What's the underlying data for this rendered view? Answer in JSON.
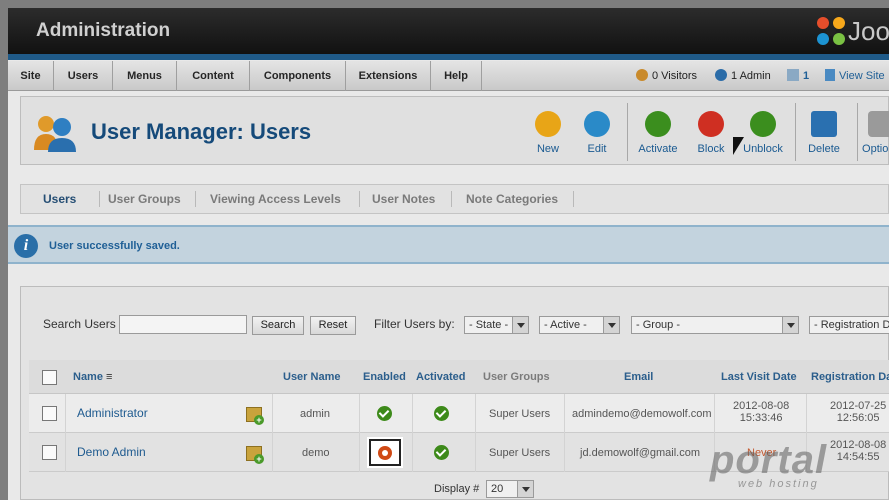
{
  "header": {
    "title": "Administration",
    "logo_text": "Joomla!"
  },
  "menu": {
    "items": [
      "Site",
      "Users",
      "Menus",
      "Content",
      "Components",
      "Extensions",
      "Help"
    ]
  },
  "status": {
    "visitors": "0 Visitors",
    "admins": "1 Admin",
    "messages": "1",
    "view_site": "View Site"
  },
  "toolbar": {
    "title": "User Manager: Users",
    "buttons": [
      {
        "label": "New",
        "color": "#e8a517"
      },
      {
        "label": "Edit",
        "color": "#2a8ac8"
      },
      {
        "label": "Activate",
        "color": "#3b8e1e"
      },
      {
        "label": "Block",
        "color": "#cf2f22"
      },
      {
        "label": "Unblock",
        "color": "#3b8e1e"
      },
      {
        "label": "Delete",
        "color": "#2a70b0"
      },
      {
        "label": "Options",
        "color": "#9a9a9a"
      }
    ]
  },
  "tabs": [
    "Users",
    "User Groups",
    "Viewing Access Levels",
    "User Notes",
    "Note Categories"
  ],
  "message": {
    "text": "User successfully saved."
  },
  "filters": {
    "search_label": "Search Users",
    "search_value": "",
    "search_button": "Search",
    "reset_button": "Reset",
    "filter_label": "Filter Users by:",
    "state": "- State -",
    "active": "- Active -",
    "group": "- Group -",
    "registration": "- Registration Date -"
  },
  "table": {
    "columns": [
      "Name",
      "User Name",
      "Enabled",
      "Activated",
      "User Groups",
      "Email",
      "Last Visit Date",
      "Registration Date"
    ],
    "rows": [
      {
        "name": "Administrator",
        "username": "admin",
        "enabled": true,
        "activated": true,
        "groups": "Super Users",
        "email": "admindemo@demowolf.com",
        "last_visit": [
          "2012-08-08",
          "15:33:46"
        ],
        "registered": [
          "2012-07-25",
          "12:56:05"
        ]
      },
      {
        "name": "Demo Admin",
        "username": "demo",
        "enabled": false,
        "activated": true,
        "groups": "Super Users",
        "email": "jd.demowolf@gmail.com",
        "last_visit": [
          "Never"
        ],
        "registered": [
          "2012-08-08",
          "14:54:55"
        ]
      }
    ]
  },
  "pagination": {
    "display_label": "Display #",
    "display_value": "20"
  },
  "watermark": {
    "main": "portal",
    "sub": "web hosting"
  }
}
